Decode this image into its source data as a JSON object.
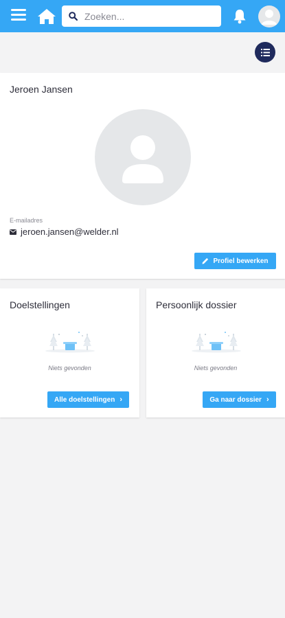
{
  "header": {
    "search_placeholder": "Zoeken..."
  },
  "profile": {
    "name": "Jeroen Jansen",
    "email_label": "E-mailadres",
    "email": "jeroen.jansen@welder.nl",
    "edit_button": "Profiel bewerken"
  },
  "goals": {
    "title": "Doelstellingen",
    "empty_text": "Niets gevonden",
    "button": "Alle doelstellingen"
  },
  "dossier": {
    "title": "Persoonlijk dossier",
    "empty_text": "Niets gevonden",
    "button": "Ga naar dossier"
  },
  "colors": {
    "primary": "#35a7f5",
    "navy": "#1f2a5c",
    "background": "#f3f3f4"
  },
  "icons": [
    "menu-icon",
    "home-icon",
    "search-icon",
    "bell-icon",
    "avatar-icon",
    "list-view-icon",
    "envelope-icon",
    "pencil-icon",
    "chevron-right-icon"
  ]
}
